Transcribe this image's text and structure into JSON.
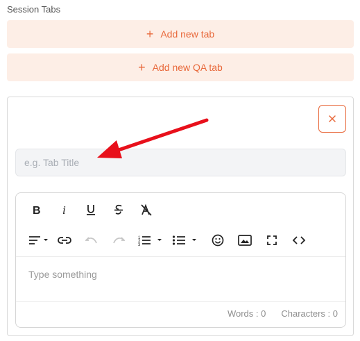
{
  "section": {
    "label": "Session Tabs"
  },
  "buttons": {
    "add_tab": {
      "icon": "plus-icon",
      "label": "Add new tab"
    },
    "add_qa_tab": {
      "icon": "plus-icon",
      "label": "Add new QA tab"
    }
  },
  "tab_card": {
    "close_icon": "close-icon",
    "title_input": {
      "placeholder": "e.g. Tab Title",
      "value": ""
    },
    "editor": {
      "toolbar_row1": [
        "bold-icon",
        "italic-icon",
        "underline-icon",
        "strikethrough-icon",
        "clear-format-icon"
      ],
      "toolbar_row2": [
        "align-icon",
        "link-icon",
        "undo-icon",
        "redo-icon",
        "ordered-list-icon",
        "bullet-list-icon",
        "emoji-icon",
        "image-icon",
        "fullscreen-icon",
        "code-icon"
      ],
      "placeholder": "Type something",
      "words_label": "Words : 0",
      "characters_label": "Characters : 0"
    }
  },
  "colors": {
    "accent": "#e8683a",
    "button_bg": "#fdeee6",
    "annotation_arrow": "#e8101b"
  }
}
